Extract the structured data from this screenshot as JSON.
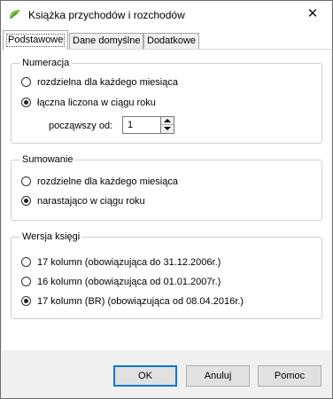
{
  "window": {
    "title": "Książka przychodów i rozchodów",
    "close_glyph": "✕",
    "icon": "kpir-app-icon"
  },
  "tabs": [
    {
      "label": "Podstawowe",
      "active": true
    },
    {
      "label": "Dane domyślne",
      "active": false
    },
    {
      "label": "Dodatkowe",
      "active": false
    }
  ],
  "numeracja": {
    "title": "Numeracja",
    "options": [
      {
        "label": "rozdzielna dla każdego miesiąca",
        "checked": false
      },
      {
        "label": "łączna liczona w ciągu roku",
        "checked": true
      }
    ],
    "start_label": "począwszy od:",
    "start_value": "1"
  },
  "sumowanie": {
    "title": "Sumowanie",
    "options": [
      {
        "label": "rozdzielne dla każdego miesiąca",
        "checked": false
      },
      {
        "label": "narastająco w ciągu roku",
        "checked": true
      }
    ]
  },
  "wersja": {
    "title": "Wersja księgi",
    "options": [
      {
        "label": "17 kolumn (obowiązująca do 31.12.2006r.)",
        "checked": false
      },
      {
        "label": "16 kolumn (obowiązująca od 01.01.2007r.)",
        "checked": false
      },
      {
        "label": "17 kolumn (BR) (obowiązująca od 08.04.2016r.)",
        "checked": true
      }
    ]
  },
  "buttons": {
    "ok": "OK",
    "cancel": "Anuluj",
    "help": "Pomoc"
  },
  "colors": {
    "accent": "#0078d7",
    "dialog_bg": "#f0f0f0",
    "panel_bg": "#ffffff"
  }
}
